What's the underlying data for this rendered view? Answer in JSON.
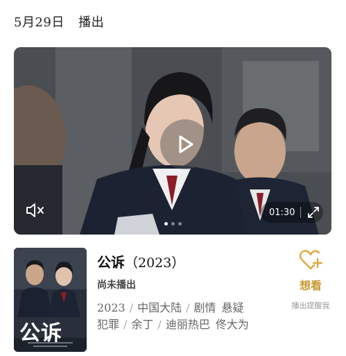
{
  "header": {
    "date": "5月29日",
    "status": "播出"
  },
  "video": {
    "duration": "01:30",
    "carousel_count": 3,
    "carousel_active": 0
  },
  "show": {
    "poster_title": "公诉",
    "title": "公诉",
    "year": "（2023）",
    "air_status": "尚未播出",
    "meta_line1": {
      "year": "2023",
      "region": "中国大陆",
      "genre1": "剧情",
      "genre2": "悬疑"
    },
    "meta_line2": {
      "genre3": "犯罪",
      "director": "余丁",
      "actor1": "迪丽热巴",
      "actor2": "佟大为"
    }
  },
  "want": {
    "label": "想看",
    "sub_label": "播出提醒我",
    "accent": "#e0a83c"
  }
}
